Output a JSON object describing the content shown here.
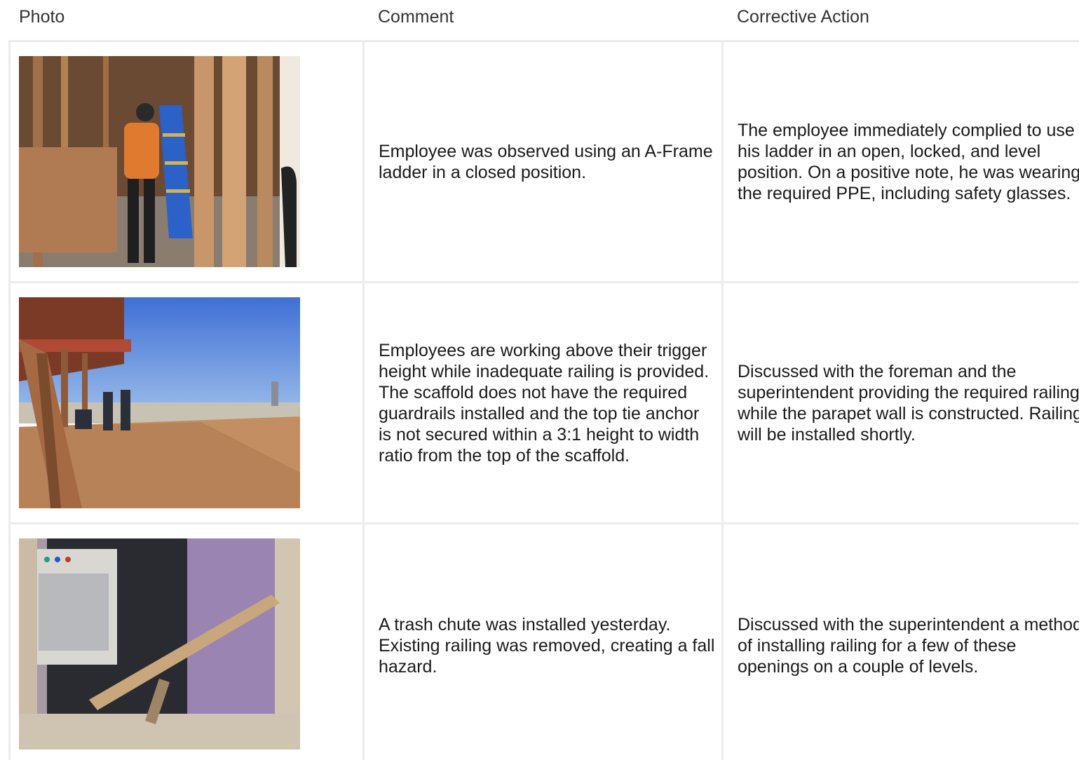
{
  "headers": {
    "photo": "Photo",
    "comment": "Comment",
    "corrective_action": "Corrective Action"
  },
  "rows": [
    {
      "photo_icon": "ladder-photo",
      "comment": "Employee was observed using an A-Frame ladder in a closed position.",
      "corrective_action": "The employee immediately complied to use his ladder in an open, locked, and level position. On a positive note, he was wearing the required PPE, including safety glasses."
    },
    {
      "photo_icon": "rooftop-photo",
      "comment": "Employees are working above their trigger height while inadequate railing is provided. The scaffold does not have the required guardrails installed and the top tie anchor is not secured within a 3:1 height to width ratio from the top of the scaffold.",
      "corrective_action": "Discussed with the foreman and the superintendent providing the required railing while the parapet wall is constructed. Railing will be installed shortly."
    },
    {
      "photo_icon": "trash-chute-photo",
      "comment": "A trash chute was installed yesterday. Existing railing was removed, creating a fall hazard.",
      "corrective_action": "Discussed with the superintendent a method of installing railing for a few of these openings on a couple of levels."
    }
  ]
}
